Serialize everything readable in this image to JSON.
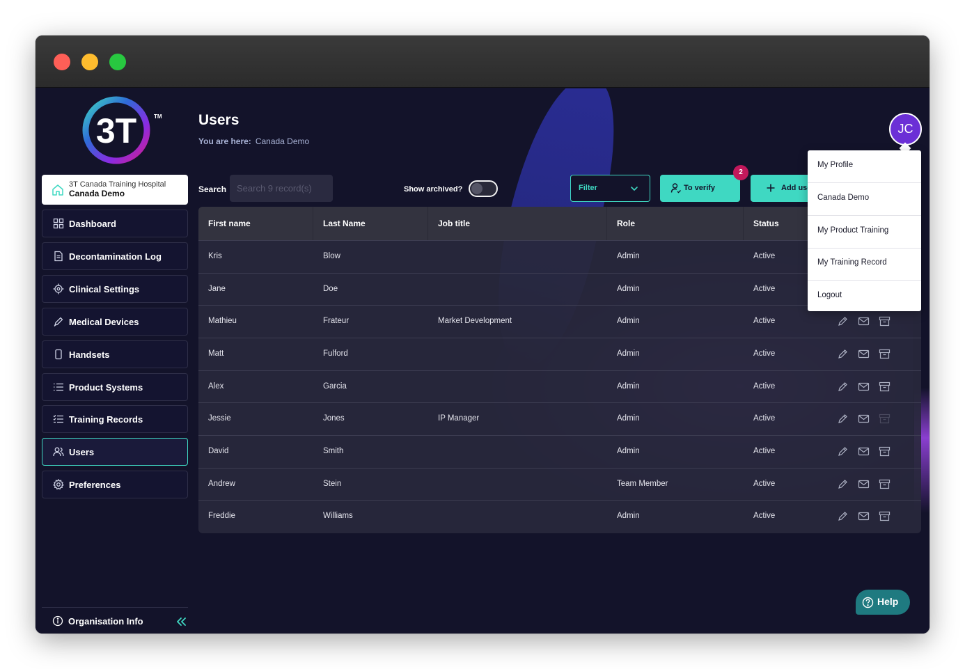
{
  "sidebar": {
    "logo_text": "3T",
    "trademark": "TM",
    "org": {
      "name": "3T Canada Training Hospital",
      "site": "Canada Demo"
    },
    "items": [
      {
        "label": "Dashboard",
        "icon": "grid-icon"
      },
      {
        "label": "Decontamination Log",
        "icon": "document-icon"
      },
      {
        "label": "Clinical Settings",
        "icon": "target-icon"
      },
      {
        "label": "Medical Devices",
        "icon": "pen-icon"
      },
      {
        "label": "Handsets",
        "icon": "phone-icon"
      },
      {
        "label": "Product Systems",
        "icon": "list-icon"
      },
      {
        "label": "Training Records",
        "icon": "checklist-icon"
      },
      {
        "label": "Users",
        "icon": "users-icon",
        "active": true
      },
      {
        "label": "Preferences",
        "icon": "gear-icon"
      }
    ],
    "footer": {
      "label": "Organisation Info",
      "icon": "info-icon",
      "collapse_icon": "double-chevron-left-icon"
    }
  },
  "header": {
    "title": "Users",
    "breadcrumb_label": "You are here:",
    "breadcrumb_value": "Canada Demo",
    "avatar_initials": "JC"
  },
  "toolbar": {
    "search_label": "Search",
    "search_placeholder": "Search 9 record(s)",
    "archived_label": "Show archived?",
    "archived_on": false,
    "filter_label": "Filter",
    "verify_label": "To verify",
    "verify_count": "2",
    "add_label": "Add user"
  },
  "table": {
    "columns": [
      "First name",
      "Last Name",
      "Job title",
      "Role",
      "Status"
    ],
    "rows": [
      {
        "first": "Kris",
        "last": "Blow",
        "job": "",
        "role": "Admin",
        "status": "Active"
      },
      {
        "first": "Jane",
        "last": "Doe",
        "job": "",
        "role": "Admin",
        "status": "Active"
      },
      {
        "first": "Mathieu",
        "last": "Frateur",
        "job": "Market Development",
        "role": "Admin",
        "status": "Active"
      },
      {
        "first": "Matt",
        "last": "Fulford",
        "job": "",
        "role": "Admin",
        "status": "Active"
      },
      {
        "first": "Alex",
        "last": "Garcia",
        "job": "",
        "role": "Admin",
        "status": "Active"
      },
      {
        "first": "Jessie",
        "last": "Jones",
        "job": "IP Manager",
        "role": "Admin",
        "status": "Active"
      },
      {
        "first": "David",
        "last": "Smith",
        "job": "",
        "role": "Admin",
        "status": "Active"
      },
      {
        "first": "Andrew",
        "last": "Stein",
        "job": "",
        "role": "Team Member",
        "status": "Active"
      },
      {
        "first": "Freddie",
        "last": "Williams",
        "job": "",
        "role": "Admin",
        "status": "Active"
      }
    ]
  },
  "user_menu": {
    "items": [
      "My Profile",
      "Canada Demo",
      "My Product Training",
      "My Training Record",
      "Logout"
    ]
  },
  "help": {
    "label": "Help"
  },
  "colors": {
    "accent": "#3fd8c2",
    "background": "#13132a",
    "badge": "#c2185b",
    "avatar": "#6b2fd6"
  }
}
